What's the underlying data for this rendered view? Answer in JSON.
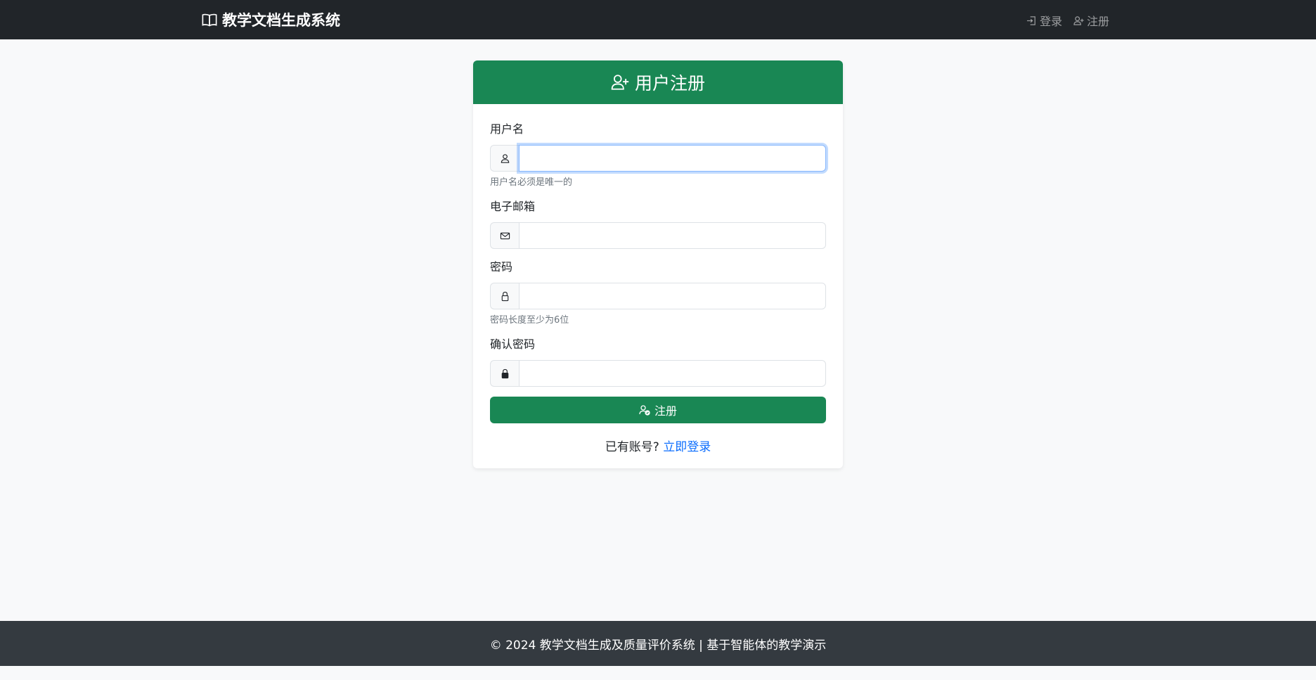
{
  "navbar": {
    "brand": "教学文档生成系统",
    "links": [
      {
        "label": "登录",
        "icon": "login-icon"
      },
      {
        "label": "注册",
        "icon": "person-plus-icon"
      }
    ]
  },
  "card": {
    "title": "用户注册",
    "fields": [
      {
        "label": "用户名",
        "icon": "person-icon",
        "value": "",
        "hint": "用户名必须是唯一的",
        "focused": true
      },
      {
        "label": "电子邮箱",
        "icon": "envelope-icon",
        "value": "",
        "hint": ""
      },
      {
        "label": "密码",
        "icon": "lock-icon",
        "value": "",
        "hint": "密码长度至少为6位"
      },
      {
        "label": "确认密码",
        "icon": "lock-fill-icon",
        "value": "",
        "hint": ""
      }
    ],
    "submit_label": "注册",
    "login_prompt": "已有账号?",
    "login_link": "立即登录"
  },
  "footer": {
    "text": "© 2024 教学文档生成及质量评价系统 | 基于智能体的教学演示"
  },
  "colors": {
    "navbar": "#212529",
    "primary_green": "#198754",
    "link_blue": "#0d6efd",
    "footer": "#343a40",
    "background": "#f8f9fa"
  }
}
